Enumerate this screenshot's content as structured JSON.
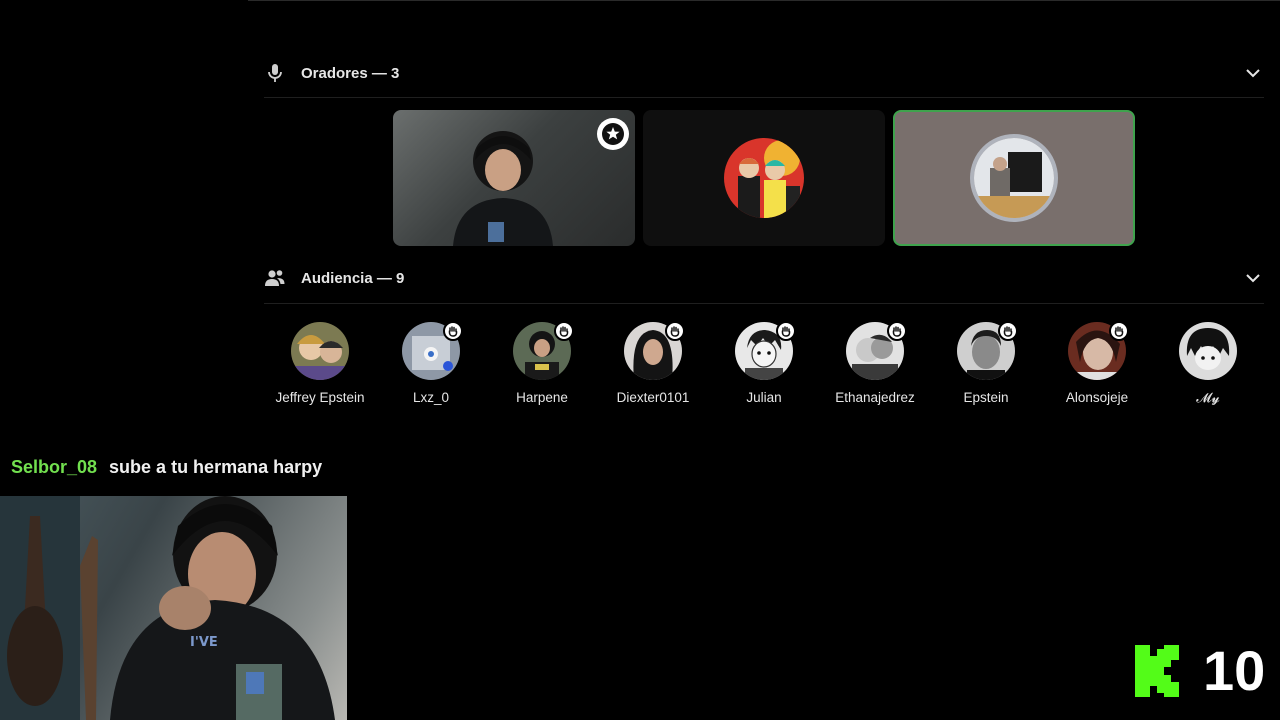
{
  "speakers": {
    "title": "Oradores — 3"
  },
  "audience": {
    "title": "Audiencia — 9",
    "members": [
      {
        "name": "Jeffrey Epstein",
        "hand_raised": false
      },
      {
        "name": "Lxz_0",
        "hand_raised": true
      },
      {
        "name": "Harpene",
        "hand_raised": true
      },
      {
        "name": "Diexter0101",
        "hand_raised": true
      },
      {
        "name": "Julian",
        "hand_raised": true
      },
      {
        "name": "Ethanajedrez",
        "hand_raised": true
      },
      {
        "name": "Epstein",
        "hand_raised": true
      },
      {
        "name": "Alonsojeje",
        "hand_raised": true
      },
      {
        "name": "𝓜𝔂",
        "hand_raised": false
      }
    ]
  },
  "chat": {
    "user": "Selbor_08",
    "message": "sube a tu hermana harpy"
  },
  "counter": {
    "value": "10"
  },
  "colors": {
    "active_speaker_border": "#3fa34d",
    "chat_username": "#72e04f",
    "logo_green": "#53fc18"
  }
}
